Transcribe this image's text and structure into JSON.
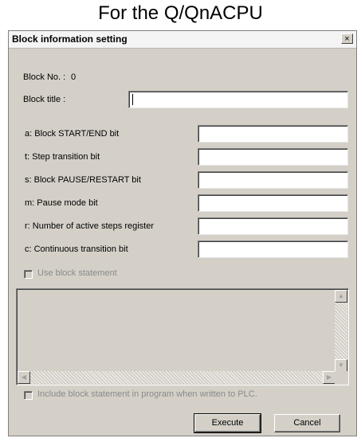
{
  "caption": "For the Q/QnACPU",
  "dialog": {
    "title": "Block information setting",
    "close_glyph": "×",
    "block_no_label": "Block No. :",
    "block_no_value": "0",
    "block_title_label": "Block title :",
    "block_title_value": "",
    "fields": [
      {
        "label": "a: Block START/END bit",
        "value": ""
      },
      {
        "label": "t: Step transition bit",
        "value": ""
      },
      {
        "label": "s: Block PAUSE/RESTART bit",
        "value": ""
      },
      {
        "label": "m: Pause mode bit",
        "value": ""
      },
      {
        "label": "r: Number of active steps register",
        "value": ""
      },
      {
        "label": "c: Continuous transition bit",
        "value": ""
      }
    ],
    "use_block_statement_label": "Use block statement",
    "include_label": "Include block statement in program when written to PLC.",
    "execute_label": "Execute",
    "cancel_label": "Cancel"
  }
}
